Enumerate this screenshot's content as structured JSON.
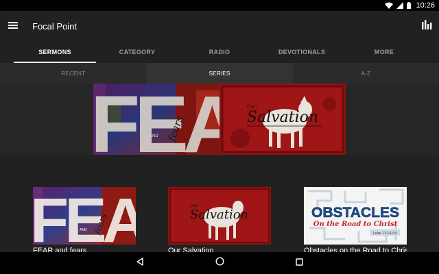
{
  "status_bar": {
    "time": "10:26",
    "icons": [
      "wifi-icon",
      "cell-signal-icon",
      "battery-icon"
    ]
  },
  "app_bar": {
    "title": "Focal Point",
    "menu_icon": "hamburger-menu-icon",
    "action_icon": "bar-chart-icon"
  },
  "tabs": [
    {
      "label": "SERMONS",
      "active": true
    },
    {
      "label": "CATEGORY",
      "active": false
    },
    {
      "label": "RADIO",
      "active": false
    },
    {
      "label": "DEVOTIONALS",
      "active": false
    },
    {
      "label": "MORE",
      "active": false
    }
  ],
  "subtabs": [
    {
      "label": "RECENT",
      "active": false
    },
    {
      "label": "SERIES",
      "active": true
    },
    {
      "label": "A-Z",
      "active": false
    }
  ],
  "featured": {
    "fear_banner": {
      "main": "FEAR",
      "and": "AND",
      "sub": "fears"
    },
    "salvation_banner": {
      "main": "Salvation",
      "prefix": "Our"
    }
  },
  "series": [
    {
      "title": "FEAR and fears",
      "art_main": "FEAR",
      "art_and": "AND",
      "art_sub": "fears"
    },
    {
      "title": "Our Salvation",
      "art_main": "Salvation",
      "art_prefix": "Our"
    },
    {
      "title": "Obstacles on the Road to Christ",
      "art_main": "OBSTACLES",
      "art_sub": "On the Road to Christ",
      "art_ref": "Luke 11:14-54"
    }
  ],
  "nav_bar": {
    "icons": [
      "back-icon",
      "home-icon",
      "recents-icon"
    ]
  },
  "colors": {
    "app_bg": "#212121",
    "subtab_bg": "#2b2b2b",
    "salvation_red": "#9c1010",
    "obstacles_blue": "#1d4f8f",
    "obstacles_red": "#c62828"
  }
}
